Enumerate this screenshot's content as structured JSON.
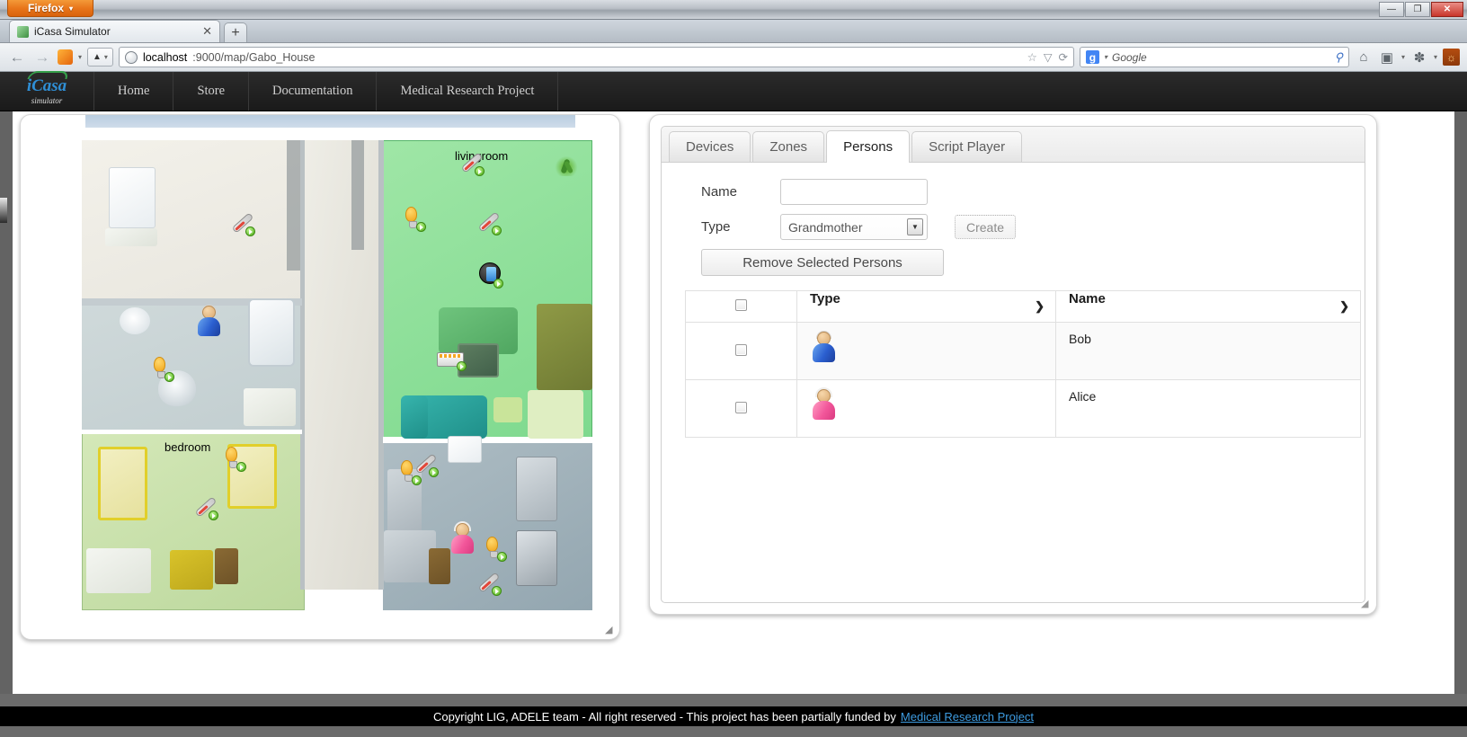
{
  "window": {
    "firefox_menu_label": "Firefox",
    "firefox_caret": "▾",
    "minimize_label": "—",
    "maximize_label": "❐",
    "close_label": "✕"
  },
  "browser": {
    "tab": {
      "title": "iCasa Simulator",
      "close_label": "✕",
      "favicon_name": "icasa-favicon"
    },
    "new_tab_label": "+",
    "back_label": "←",
    "forward_label": "→",
    "reload_label": "⟳",
    "identity_caret": "▾",
    "url_host": "localhost",
    "url_rest": ":9000/map/Gabo_House",
    "bookmark_star": "☆",
    "bookmark_caret": "▽",
    "search_engine": "Google",
    "search_placeholder": "Google",
    "search_caret": "▾",
    "search_magnifier": "⚲",
    "home_label": "⌂",
    "bookmarks_label": "▣",
    "bookmarks_caret": "▾",
    "addons_label": "✽",
    "addons_caret": "▾",
    "menu_label": "☼"
  },
  "site": {
    "brand": {
      "name": "iCasa",
      "sub": "simulator"
    },
    "nav": [
      {
        "label": "Home"
      },
      {
        "label": "Store"
      },
      {
        "label": "Documentation"
      },
      {
        "label": "Medical Research Project"
      }
    ]
  },
  "map": {
    "title": "Gabo_House",
    "rooms": [
      {
        "name": "livingroom",
        "label": "livingroom"
      },
      {
        "name": "bedroom",
        "label": "bedroom"
      }
    ],
    "resize_handle": "◢"
  },
  "panel": {
    "tabs": [
      {
        "label": "Devices",
        "active": false
      },
      {
        "label": "Zones",
        "active": false
      },
      {
        "label": "Persons",
        "active": true
      },
      {
        "label": "Script Player",
        "active": false
      }
    ],
    "form": {
      "name_label": "Name",
      "name_value": "",
      "name_placeholder": "",
      "type_label": "Type",
      "type_value": "Grandmother",
      "type_caret": "▼",
      "create_label": "Create",
      "remove_label": "Remove Selected Persons"
    },
    "table": {
      "columns": [
        {
          "key": "check",
          "label": ""
        },
        {
          "key": "type",
          "label": "Type"
        },
        {
          "key": "name",
          "label": "Name"
        }
      ],
      "sort_caret": "❯",
      "rows": [
        {
          "checked": false,
          "type_icon": "grandfather-avatar",
          "name": "Bob"
        },
        {
          "checked": false,
          "type_icon": "grandmother-avatar",
          "name": "Alice"
        }
      ]
    },
    "resize_handle": "◢"
  },
  "footer": {
    "text": "Copyright LIG, ADELE team - All right reserved - This project has been partially funded by",
    "link": "Medical Research Project"
  },
  "colors": {
    "accent_orange": "#e8751a",
    "brand_blue": "#2f8fd6",
    "brand_green": "#35a04a",
    "link_blue": "#3d9be0",
    "livingroom_green": "#7ed98e",
    "bedroom_green": "#bcd89d"
  }
}
